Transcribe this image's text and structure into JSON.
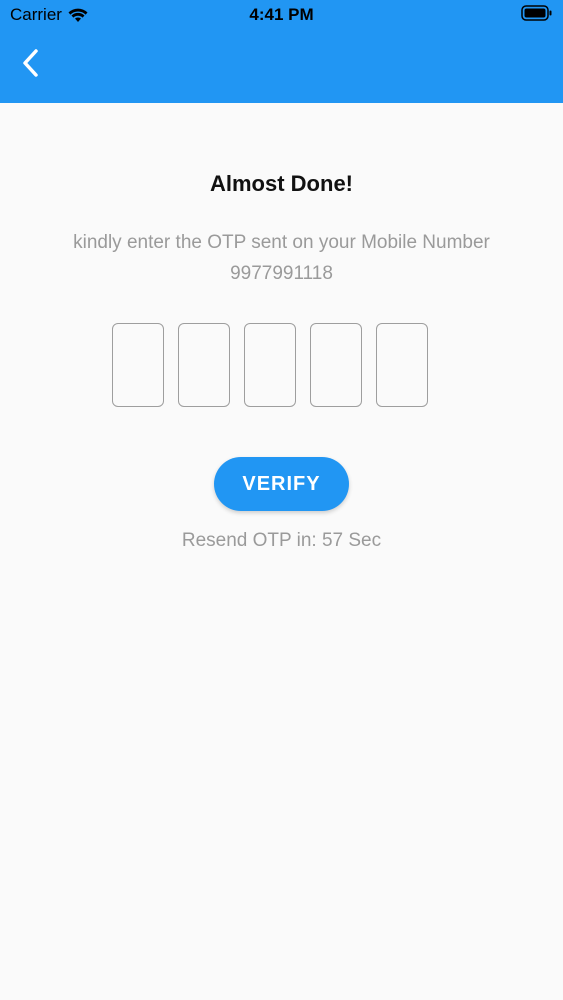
{
  "status_bar": {
    "carrier": "Carrier",
    "time": "4:41 PM"
  },
  "app_bar": {
    "color": "#2196f3",
    "back_icon": "chevron-left-icon"
  },
  "main": {
    "title": "Almost Done!",
    "subtitle": "kindly enter the OTP sent on your Mobile Number",
    "phone_number": "9977991118",
    "otp_fields": [
      "",
      "",
      "",
      "",
      ""
    ],
    "verify_label": "VERIFY",
    "resend_text": "Resend OTP in: 57 Sec"
  }
}
